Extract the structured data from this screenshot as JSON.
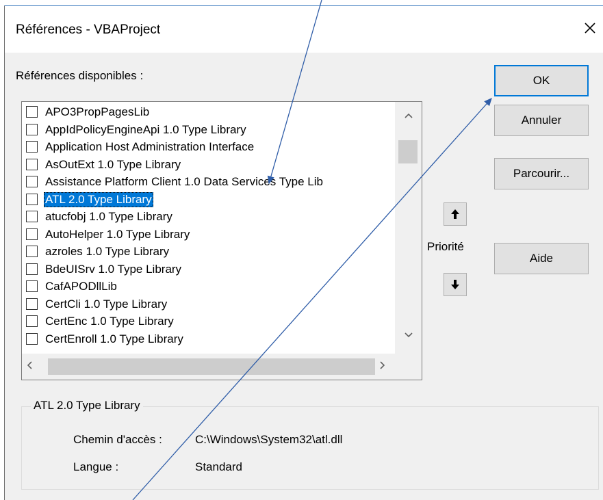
{
  "dialog": {
    "title": "Références - VBAProject",
    "icons": {
      "close": "close-icon"
    }
  },
  "available": {
    "label": "Références disponibles :",
    "items": [
      {
        "label": "APO3PropPagesLib",
        "checked": false,
        "selected": false
      },
      {
        "label": "AppIdPolicyEngineApi 1.0 Type Library",
        "checked": false,
        "selected": false
      },
      {
        "label": "Application Host Administration Interface",
        "checked": false,
        "selected": false
      },
      {
        "label": "AsOutExt 1.0 Type Library",
        "checked": false,
        "selected": false
      },
      {
        "label": "Assistance Platform Client 1.0 Data Services Type Lib",
        "checked": false,
        "selected": false
      },
      {
        "label": "ATL 2.0 Type Library",
        "checked": false,
        "selected": true
      },
      {
        "label": "atucfobj 1.0 Type Library",
        "checked": false,
        "selected": false
      },
      {
        "label": "AutoHelper 1.0 Type Library",
        "checked": false,
        "selected": false
      },
      {
        "label": "azroles 1.0 Type Library",
        "checked": false,
        "selected": false
      },
      {
        "label": "BdeUISrv 1.0 Type Library",
        "checked": false,
        "selected": false
      },
      {
        "label": "CafAPODllLib",
        "checked": false,
        "selected": false
      },
      {
        "label": "CertCli 1.0 Type Library",
        "checked": false,
        "selected": false
      },
      {
        "label": "CertEnc 1.0 Type Library",
        "checked": false,
        "selected": false
      },
      {
        "label": "CertEnroll 1.0 Type Library",
        "checked": false,
        "selected": false
      }
    ]
  },
  "buttons": {
    "ok": "OK",
    "cancel": "Annuler",
    "browse": "Parcourir...",
    "help": "Aide"
  },
  "priority": {
    "label": "Priorité",
    "icons": {
      "up": "arrow-up-icon",
      "down": "arrow-down-icon"
    }
  },
  "details": {
    "group_title": "ATL 2.0 Type Library",
    "path_label": "Chemin d'accès :",
    "path_value": "C:\\Windows\\System32\\atl.dll",
    "language_label": "Langue :",
    "language_value": "Standard"
  },
  "colors": {
    "selection": "#0078d7",
    "annotation_arrow": "#2f5da8"
  }
}
